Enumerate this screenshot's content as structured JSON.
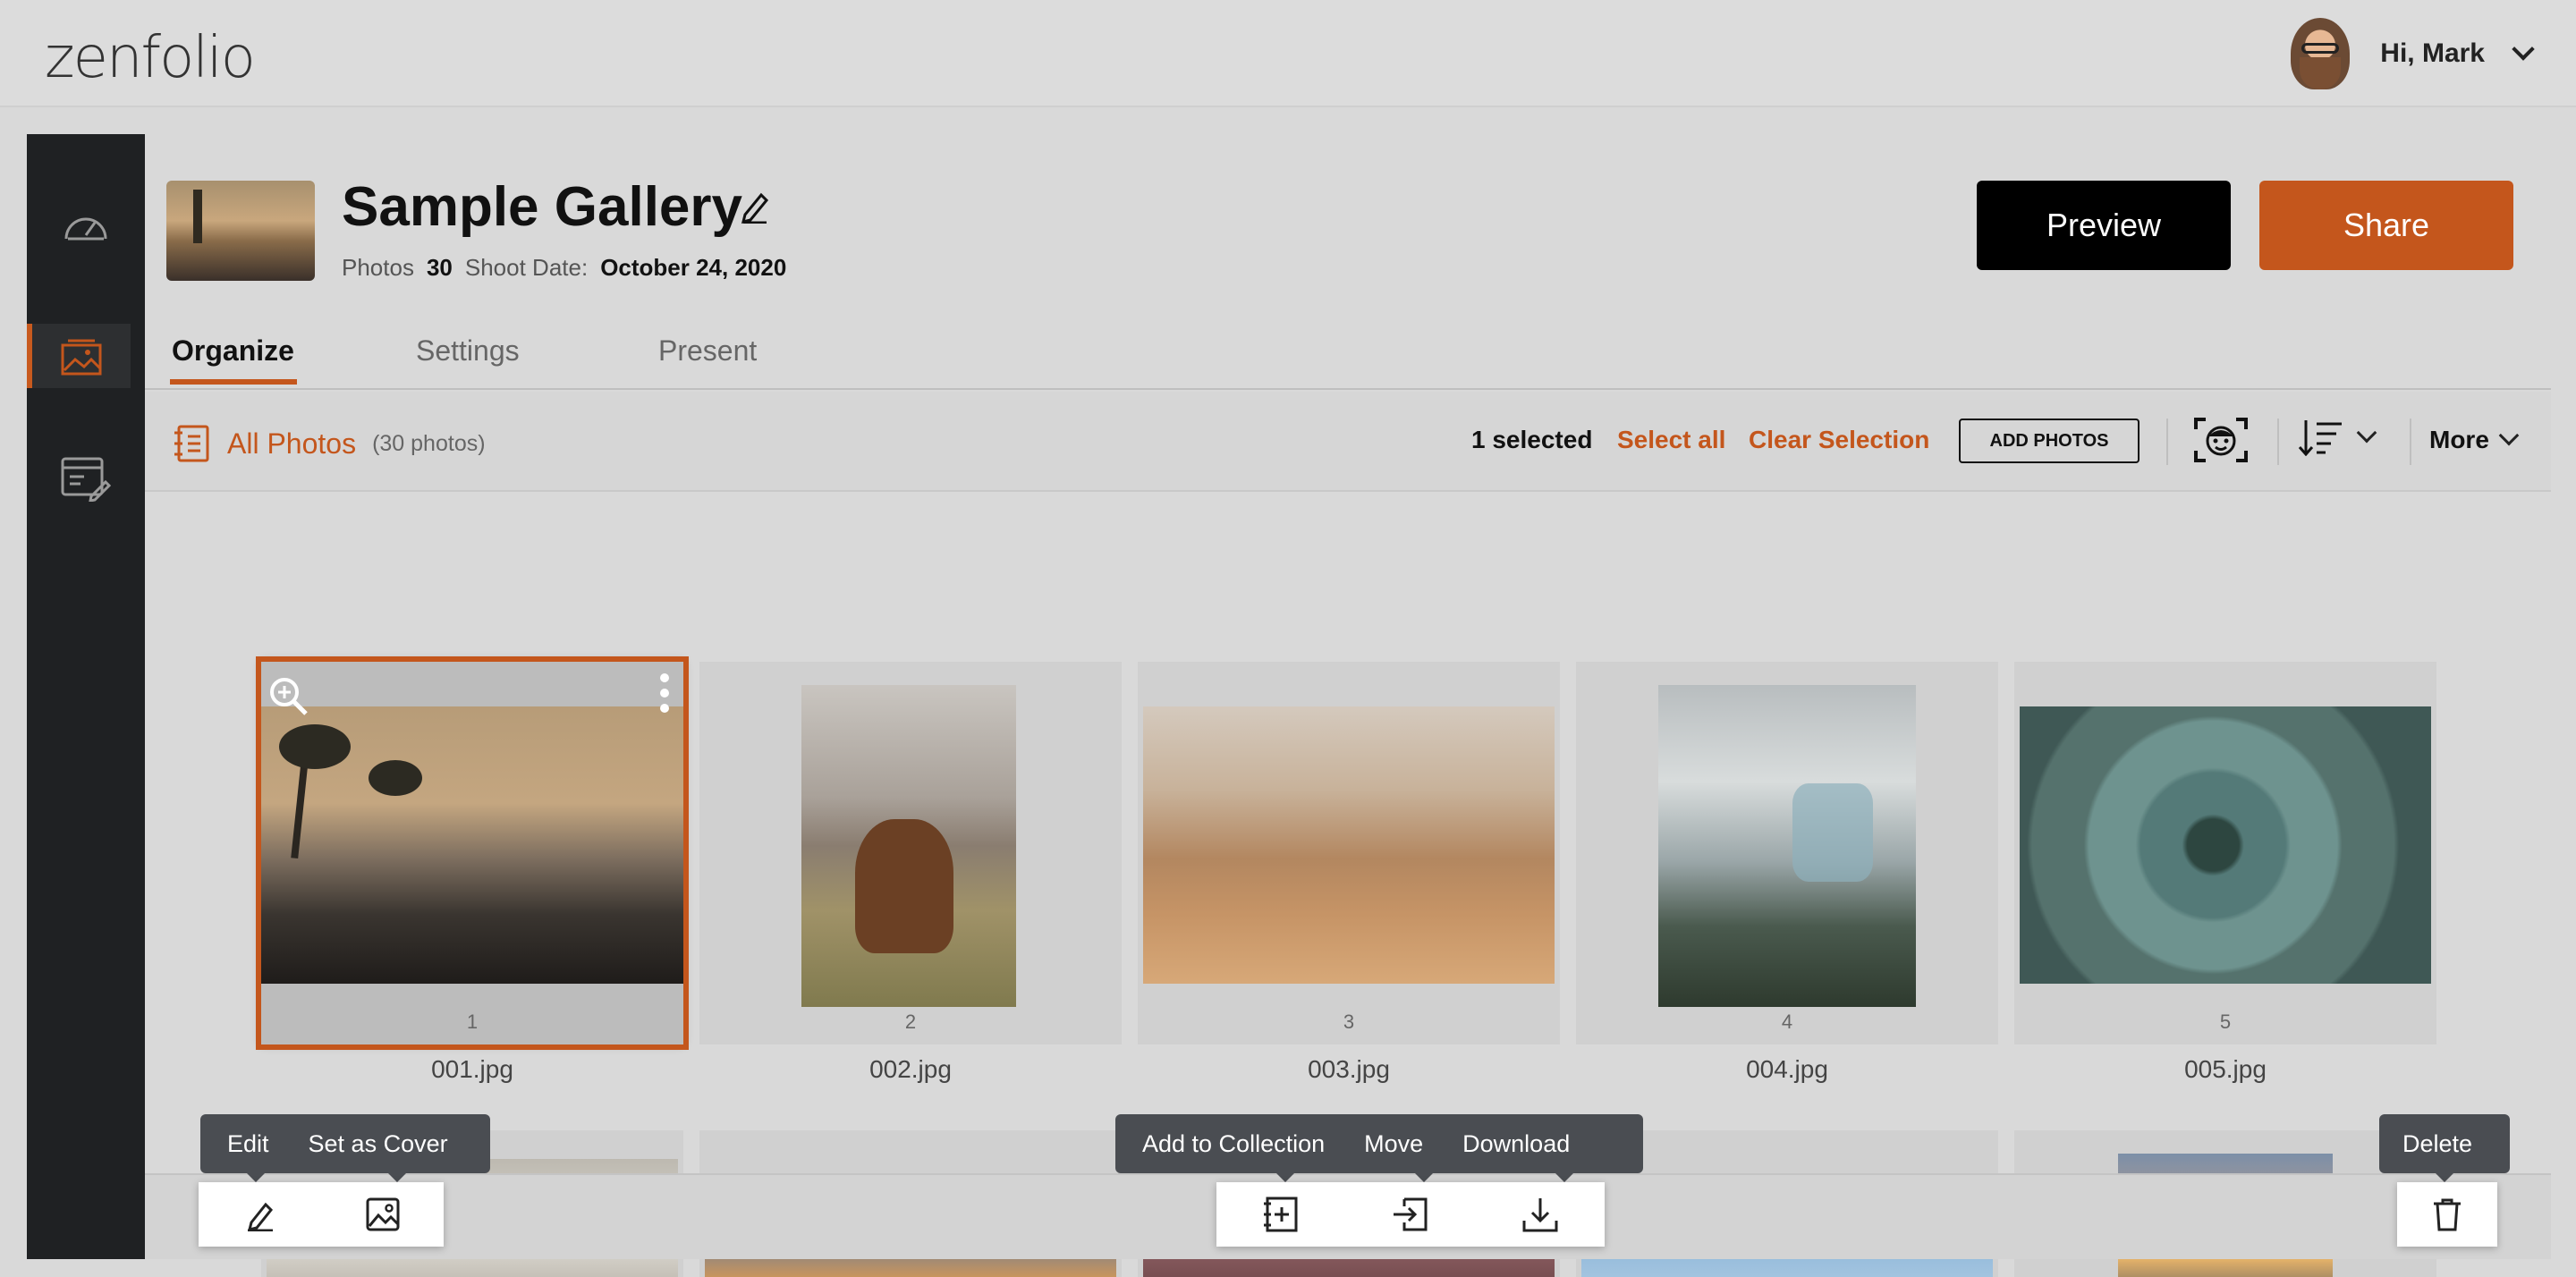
{
  "header": {
    "logo": "zenfolio",
    "user_greeting": "Hi, Mark"
  },
  "sidebar": {
    "items": [
      {
        "name": "dashboard",
        "icon": "speedometer-icon"
      },
      {
        "name": "galleries",
        "icon": "gallery-icon",
        "active": true
      },
      {
        "name": "website",
        "icon": "web-edit-icon"
      }
    ]
  },
  "gallery": {
    "title": "Sample Gallery",
    "photos_label": "Photos",
    "photos_count": "30",
    "shoot_date_label": "Shoot Date:",
    "shoot_date": "October 24, 2020",
    "preview_label": "Preview",
    "share_label": "Share"
  },
  "tabs": [
    "Organize",
    "Settings",
    "Present"
  ],
  "toolbar": {
    "all_photos_label": "All Photos",
    "all_photos_count": "(30 photos)",
    "selected": "1 selected",
    "select_all": "Select all",
    "clear_selection": "Clear Selection",
    "add_photos": "ADD PHOTOS",
    "more": "More"
  },
  "photos": [
    {
      "number": "1",
      "filename": "001.jpg",
      "selected": true
    },
    {
      "number": "2",
      "filename": "002.jpg"
    },
    {
      "number": "3",
      "filename": "003.jpg"
    },
    {
      "number": "4",
      "filename": "004.jpg"
    },
    {
      "number": "5",
      "filename": "005.jpg"
    }
  ],
  "actions": {
    "edit": "Edit",
    "set_as_cover": "Set as Cover",
    "add_to_collection": "Add to Collection",
    "move": "Move",
    "download": "Download",
    "delete": "Delete"
  },
  "colors": {
    "accent": "#c4561c",
    "sidebar": "#1f2123"
  }
}
